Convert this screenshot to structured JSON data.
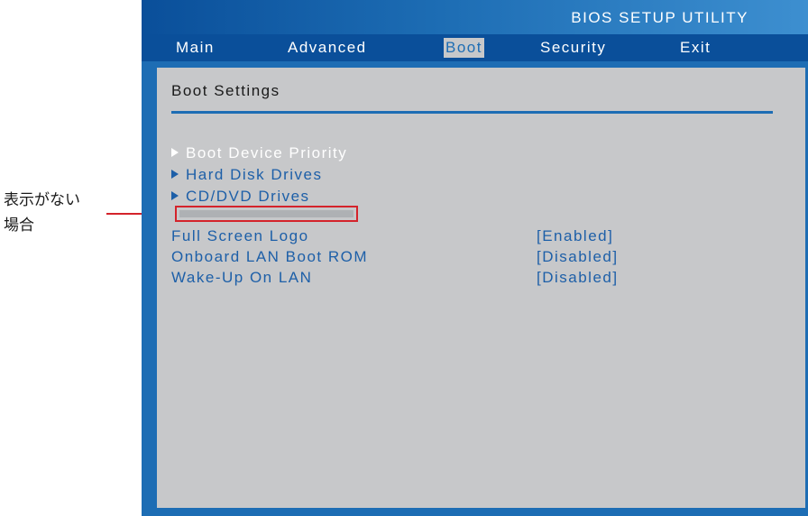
{
  "annotation": {
    "line1": "表示がない",
    "line2": "場合"
  },
  "bios": {
    "title": "BIOS SETUP UTILITY",
    "menu": [
      "Main",
      "Advanced",
      "Boot",
      "Security",
      "Exit"
    ],
    "active_menu": "Boot",
    "panel_title": "Boot Settings",
    "submenus": [
      {
        "label": "Boot Device Priority",
        "highlighted": true
      },
      {
        "label": "Hard Disk Drives",
        "highlighted": false
      },
      {
        "label": "CD/DVD Drives",
        "highlighted": false
      }
    ],
    "settings": [
      {
        "label": "Full Screen Logo",
        "value": "[Enabled]"
      },
      {
        "label": "Onboard LAN Boot ROM",
        "value": "[Disabled]"
      },
      {
        "label": "Wake-Up On LAN",
        "value": "[Disabled]"
      }
    ]
  },
  "colors": {
    "bios_blue": "#1d6db4",
    "panel_gray": "#c7c8ca",
    "callout_red": "#d4232b",
    "highlight_text": "#ffffff"
  }
}
